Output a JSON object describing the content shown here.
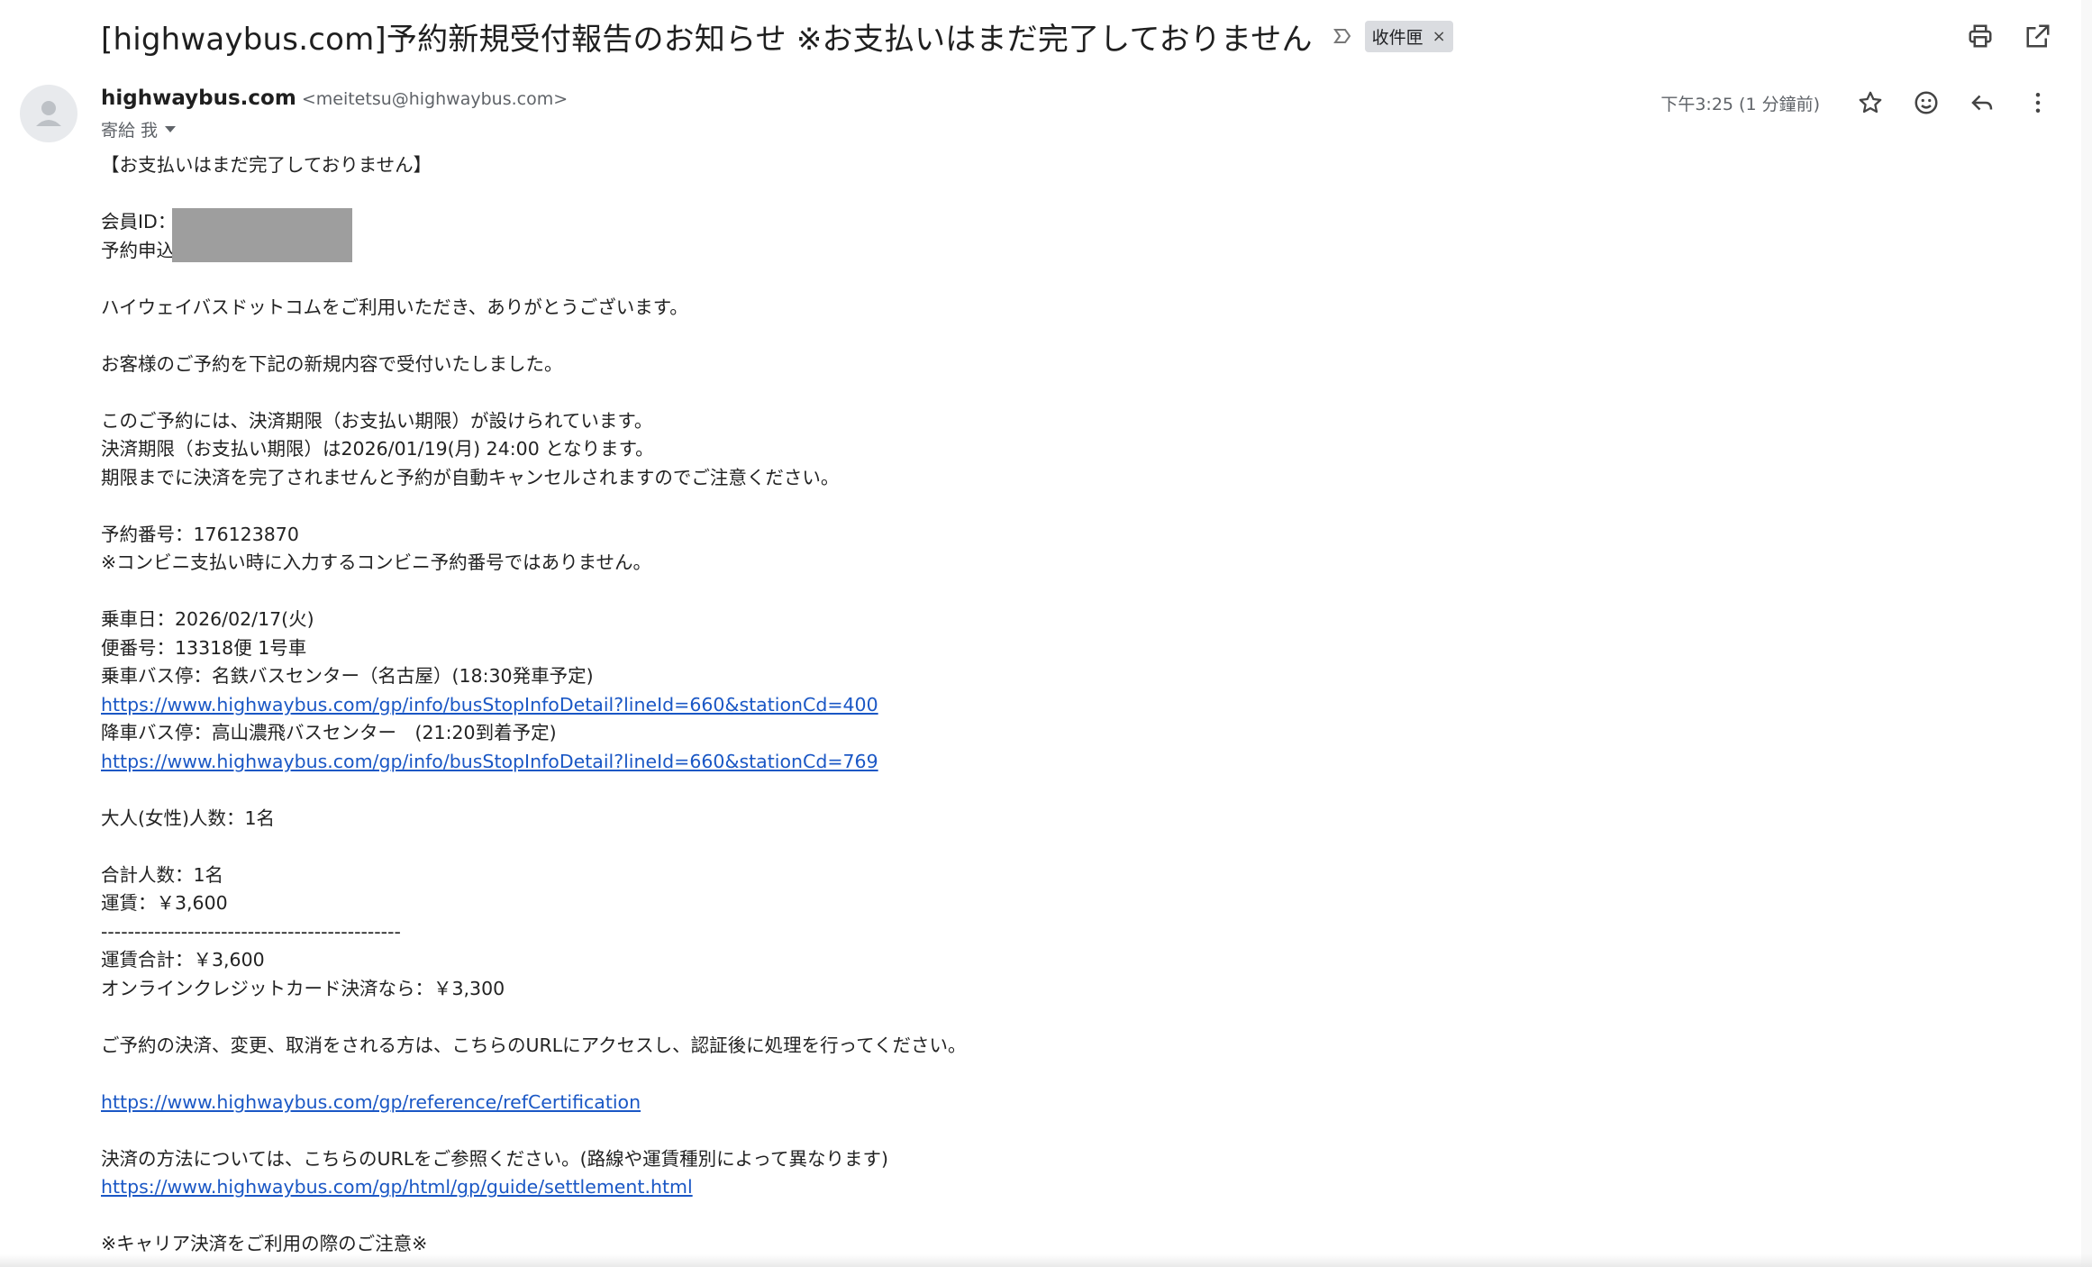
{
  "header": {
    "subject": "[highwaybus.com]予約新規受付報告のお知らせ ※お支払いはまだ完了しておりません",
    "label": "收件匣",
    "label_remove": "×"
  },
  "icons": {
    "print": "print-icon",
    "open_new": "open-in-new-icon",
    "star": "star-icon",
    "emoji": "emoji-icon",
    "reply": "reply-icon",
    "more": "more-vert-icon",
    "importance": "importance-marker-icon"
  },
  "sender": {
    "name": "highwaybus.com",
    "email": "<meitetsu@highwaybus.com>",
    "to": "寄給 我",
    "time": "下午3:25 (1 分鐘前)"
  },
  "body": {
    "l01": "【お支払いはまだ完了しておりません】",
    "l02": "会員ID：",
    "l03": "予約申込",
    "l04": "ハイウェイバスドットコムをご利用いただき、ありがとうございます。",
    "l05": "お客様のご予約を下記の新規内容で受付いたしました。",
    "l06": "このご予約には、決済期限（お支払い期限）が設けられています。",
    "l07": "決済期限（お支払い期限）は2026/01/19(月) 24:00 となります。",
    "l08": "期限までに決済を完了されませんと予約が自動キャンセルされますのでご注意ください。",
    "l09": "予約番号：176123870",
    "l10": "※コンビニ支払い時に入力するコンビニ予約番号ではありません。",
    "l11": "乗車日：2026/02/17(火)",
    "l12": "便番号：13318便 1号車",
    "l13": "乗車バス停：名鉄バスセンター（名古屋）(18:30発車予定)",
    "link1": "https://www.highwaybus.com/gp/info/busStopInfoDetail?lineId=660&stationCd=400",
    "l14": "降車バス停：高山濃飛バスセンター　(21:20到着予定)",
    "link2": "https://www.highwaybus.com/gp/info/busStopInfoDetail?lineId=660&stationCd=769",
    "l15": "大人(女性)人数：1名",
    "l16": "合計人数：1名",
    "l17": "運賃：￥3,600",
    "l18": "---------------------------------------------",
    "l19": "運賃合計：￥3,600",
    "l20": "オンラインクレジットカード決済なら：￥3,300",
    "l21": "ご予約の決済、変更、取消をされる方は、こちらのURLにアクセスし、認証後に処理を行ってください。",
    "link3": "https://www.highwaybus.com/gp/reference/refCertification",
    "l22": "決済の方法については、こちらのURLをご参照ください。(路線や運賃種別によって異なります)",
    "link4": "https://www.highwaybus.com/gp/html/gp/guide/settlement.html",
    "l23": "※キャリア決済をご利用の際のご注意※"
  },
  "colors": {
    "link": "#1a57c5",
    "label_chip": "#dadce0",
    "redaction": "#9e9e9e"
  }
}
